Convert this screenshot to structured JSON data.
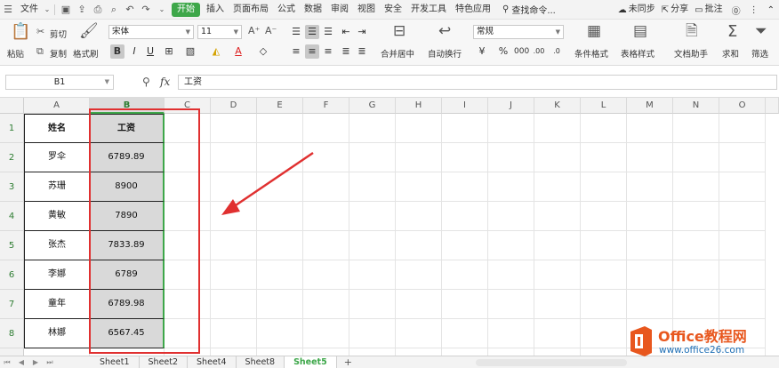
{
  "menubar": {
    "file_label": "文件",
    "tabs": [
      "开始",
      "插入",
      "页面布局",
      "公式",
      "数据",
      "审阅",
      "视图",
      "安全",
      "开发工具",
      "特色应用"
    ],
    "active_tab": "开始",
    "search_label": "查找命令...",
    "sync_label": "未同步",
    "share_label": "分享",
    "comment_label": "批注"
  },
  "ribbon": {
    "paste_label": "粘贴",
    "cut_label": "剪切",
    "copy_label": "复制",
    "format_painter_label": "格式刷",
    "font_name": "宋体",
    "font_size": "11",
    "merge_label": "合并居中",
    "wrap_label": "自动换行",
    "number_format": "常规",
    "cond_format_label": "条件格式",
    "table_style_label": "表格样式",
    "doc_helper_label": "文档助手",
    "sum_label": "求和",
    "filter_label": "筛选"
  },
  "formula_bar": {
    "name_box": "B1",
    "fx_label": "fx",
    "content": "工资"
  },
  "columns": [
    "A",
    "B",
    "C",
    "D",
    "E",
    "F",
    "G",
    "H",
    "I",
    "J",
    "K",
    "L",
    "M",
    "N",
    "O"
  ],
  "rows": [
    "1",
    "2",
    "3",
    "4",
    "5",
    "6",
    "7",
    "8"
  ],
  "table": {
    "header_a": "姓名",
    "header_b": "工资",
    "rows": [
      {
        "name": "罗伞",
        "salary": "6789.89"
      },
      {
        "name": "苏珊",
        "salary": "8900"
      },
      {
        "name": "黄敏",
        "salary": "7890"
      },
      {
        "name": "张杰",
        "salary": "7833.89"
      },
      {
        "name": "李娜",
        "salary": "6789"
      },
      {
        "name": "童年",
        "salary": "6789.98"
      },
      {
        "name": "林娜",
        "salary": "6567.45"
      }
    ]
  },
  "sheets": [
    "Sheet1",
    "Sheet2",
    "Sheet4",
    "Sheet8",
    "Sheet5"
  ],
  "active_sheet": "Sheet5",
  "logo": {
    "brand": "Office教程网",
    "url": "www.office26.com"
  },
  "colors": {
    "accent_green": "#3ea74a",
    "annotation_red": "#e03030",
    "logo_orange": "#e8571e",
    "logo_blue": "#1f6fb5"
  }
}
